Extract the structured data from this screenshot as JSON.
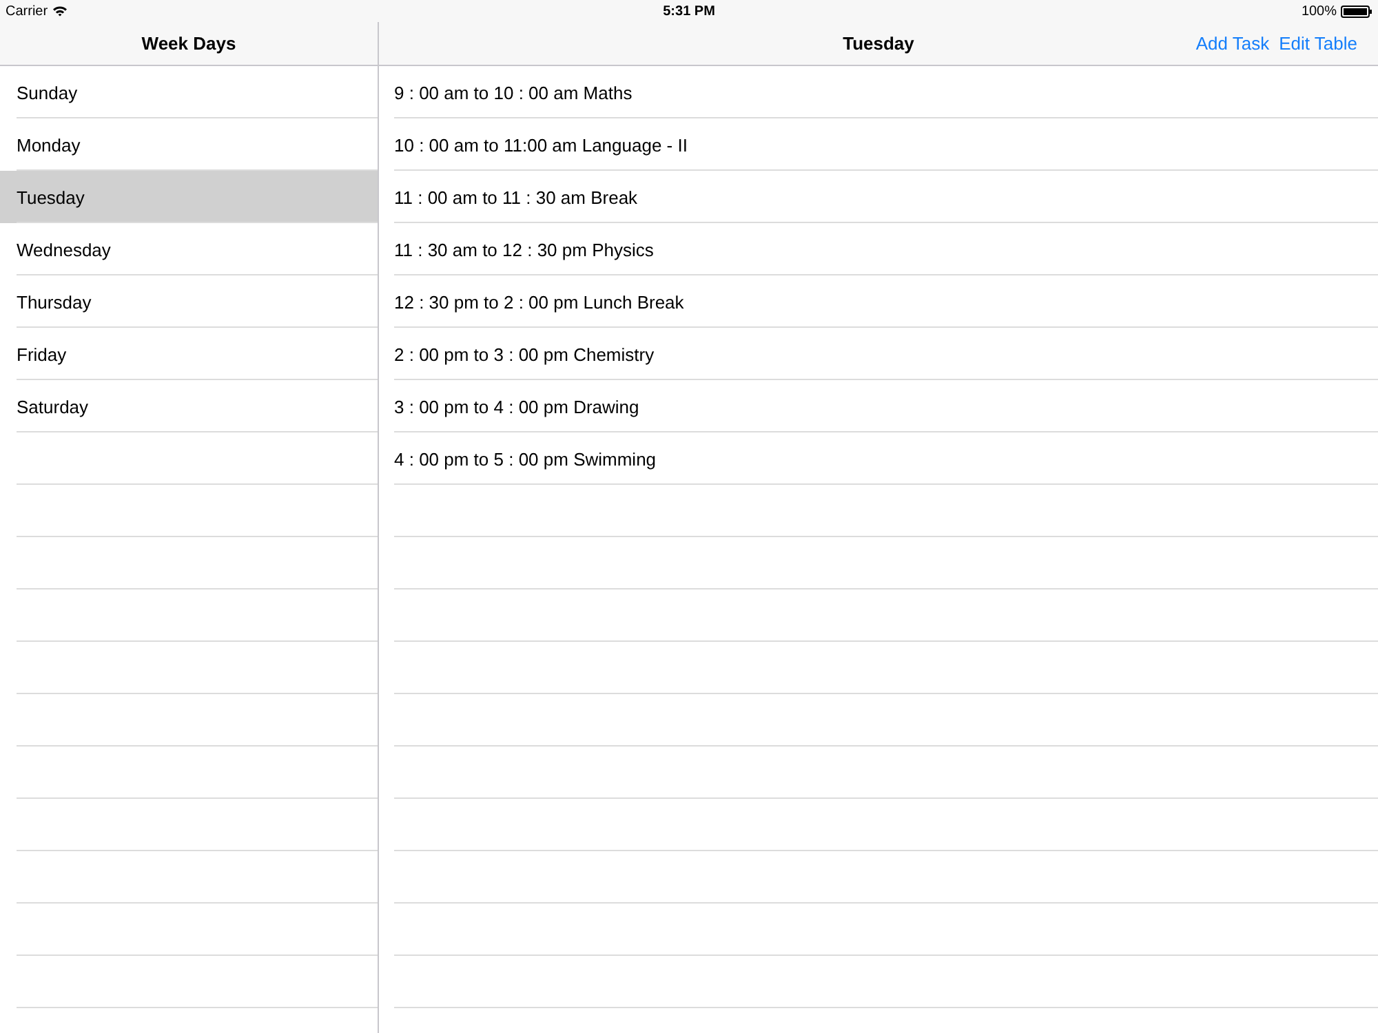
{
  "status_bar": {
    "carrier": "Carrier",
    "time": "5:31 PM",
    "battery": "100%"
  },
  "sidebar": {
    "title": "Week Days",
    "items": [
      {
        "label": "Sunday",
        "selected": false
      },
      {
        "label": "Monday",
        "selected": false
      },
      {
        "label": "Tuesday",
        "selected": true
      },
      {
        "label": "Wednesday",
        "selected": false
      },
      {
        "label": "Thursday",
        "selected": false
      },
      {
        "label": "Friday",
        "selected": false
      },
      {
        "label": "Saturday",
        "selected": false
      }
    ]
  },
  "detail": {
    "title": "Tuesday",
    "actions": [
      "Add Task",
      "Edit Table"
    ],
    "rows": [
      "9 : 00 am to 10 : 00 am Maths",
      "10 : 00 am to 11:00 am Language - II",
      "11 : 00 am to 11 : 30 am Break",
      "11 : 30 am to 12 : 30 pm Physics",
      "12 : 30 pm to 2 : 00 pm Lunch Break",
      "2 : 00 pm to 3 : 00 pm Chemistry",
      "3 : 00 pm to 4 : 00 pm Drawing",
      "4 : 00 pm to 5 : 00 pm Swimming"
    ]
  }
}
